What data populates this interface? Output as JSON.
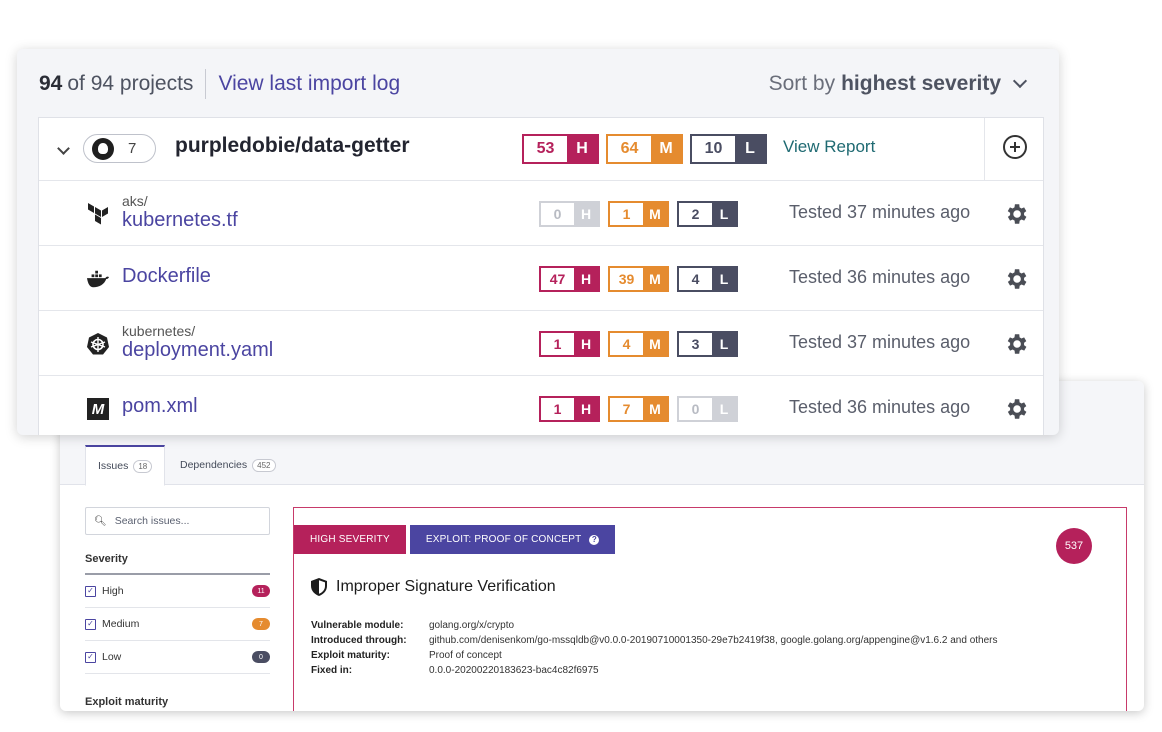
{
  "projects": {
    "count": "94",
    "count_suffix": "of 94 projects",
    "import_log_link": "View last import log",
    "sort_prefix": "Sort by",
    "sort_value": "highest severity",
    "repo": {
      "source_count": "7",
      "name": "purpledobie/data-getter",
      "high": "53",
      "medium": "64",
      "low": "10",
      "view_report": "View Report"
    },
    "files": [
      {
        "path": "aks/",
        "name": "kubernetes.tf",
        "icon": "terraform-icon",
        "high": "0",
        "medium": "1",
        "low": "2",
        "tested": "Tested 37 minutes ago"
      },
      {
        "path": "",
        "name": "Dockerfile",
        "icon": "docker-icon",
        "high": "47",
        "medium": "39",
        "low": "4",
        "tested": "Tested 36 minutes ago"
      },
      {
        "path": "kubernetes/",
        "name": "deployment.yaml",
        "icon": "kubernetes-icon",
        "high": "1",
        "medium": "4",
        "low": "3",
        "tested": "Tested 37 minutes ago"
      },
      {
        "path": "",
        "name": "pom.xml",
        "icon": "maven-icon",
        "high": "1",
        "medium": "7",
        "low": "0",
        "tested": "Tested 36 minutes ago"
      }
    ],
    "labels": {
      "high": "H",
      "medium": "M",
      "low": "L"
    }
  },
  "issues_panel": {
    "tabs": [
      {
        "label": "Issues",
        "count": "18"
      },
      {
        "label": "Dependencies",
        "count": "452"
      }
    ],
    "search_placeholder": "Search issues...",
    "severity_heading": "Severity",
    "filters": [
      {
        "label": "High",
        "count": "11",
        "color": "#b5215b"
      },
      {
        "label": "Medium",
        "count": "7",
        "color": "#e58b2f"
      },
      {
        "label": "Low",
        "count": "0",
        "color": "#4a4d62"
      }
    ],
    "exploit_heading": "Exploit maturity",
    "issue": {
      "severity_tag": "HIGH SEVERITY",
      "exploit_tag": "EXPLOIT: PROOF OF CONCEPT",
      "score": "537",
      "title": "Improper Signature Verification",
      "meta": [
        {
          "key": "Vulnerable module:",
          "value": "golang.org/x/crypto"
        },
        {
          "key": "Introduced through:",
          "value": "github.com/denisenkom/go-mssqldb@v0.0.0-20190710001350-29e7b2419f38, google.golang.org/appengine@v1.6.2 and others"
        },
        {
          "key": "Exploit maturity:",
          "value": "Proof of concept"
        },
        {
          "key": "Fixed in:",
          "value": "0.0.0-20200220183623-bac4c82f6975"
        }
      ]
    }
  },
  "colors": {
    "high": "#b5215b",
    "medium": "#e58b2f",
    "low": "#4a4d62",
    "brand": "#4b45a1",
    "zero": "#cfd1d7"
  }
}
